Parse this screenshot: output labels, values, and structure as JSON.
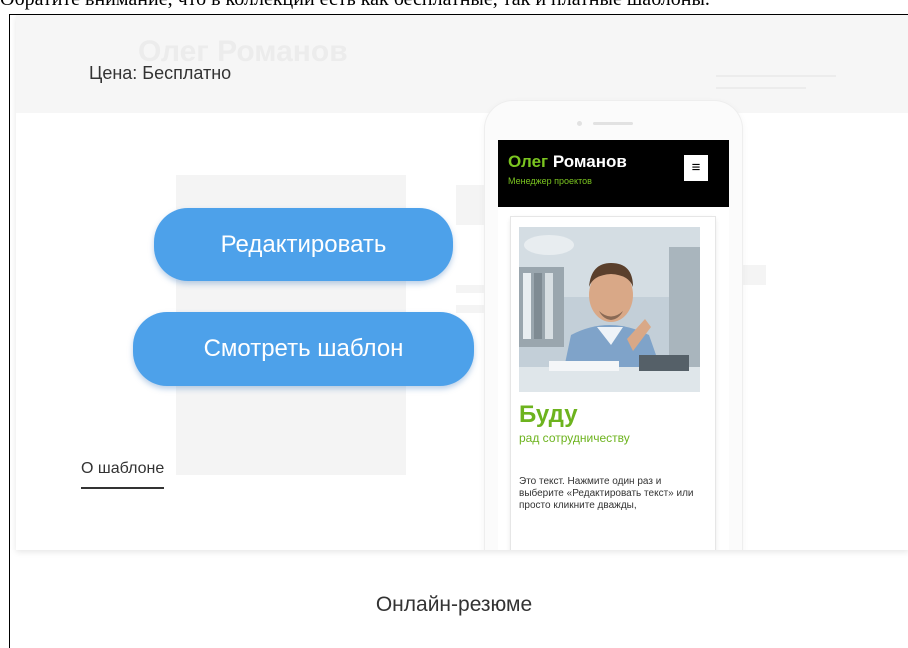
{
  "top_text": "Обратите внимание, что в коллекции есть как бесплатные, так и платные шаблоны.",
  "template": {
    "price_label": "Цена: Бесплатно",
    "ghost_title": "Олег Романов",
    "edit_button": "Редактировать",
    "view_button": "Смотреть шаблон",
    "about_link": "О шаблоне",
    "caption": "Онлайн-резюме"
  },
  "phone_preview": {
    "site_name_first": "Олег",
    "site_name_last": "Романов",
    "site_subtitle": "Менеджер проектов",
    "menu_icon": "hamburger-menu-icon",
    "heading": "Буду",
    "subheading": "рад сотрудничеству",
    "body_text": "Это текст. Нажмите один раз и выберите «Редактировать текст» или просто кликните дважды,"
  },
  "colors": {
    "button_blue": "#4da1ea",
    "site_green": "#7bc520",
    "header_black": "#000000"
  }
}
